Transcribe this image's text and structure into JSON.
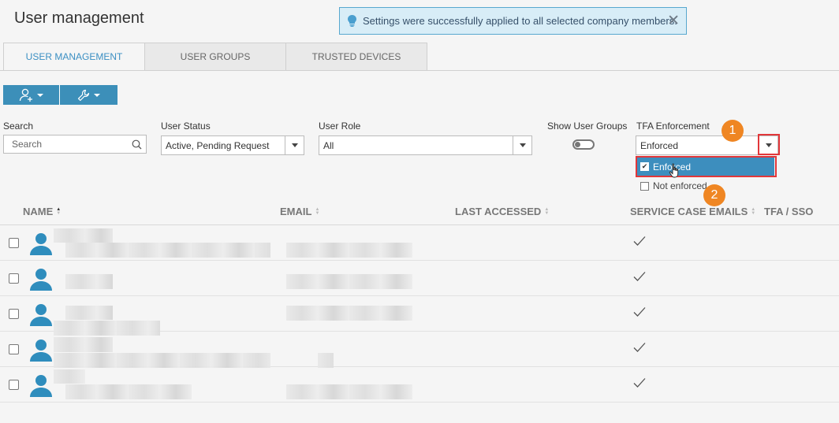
{
  "page": {
    "title": "User management"
  },
  "notification": {
    "message": "Settings were successfully applied to all selected company members.",
    "close": "✕"
  },
  "tabs": [
    {
      "label": "USER MANAGEMENT",
      "active": true
    },
    {
      "label": "USER GROUPS",
      "active": false
    },
    {
      "label": "TRUSTED DEVICES",
      "active": false
    }
  ],
  "toolbar": {
    "add_user_icon": "add-user-icon",
    "settings_icon": "wrench-icon"
  },
  "filters": {
    "search": {
      "label": "Search",
      "placeholder": "Search"
    },
    "user_status": {
      "label": "User Status",
      "value": "Active, Pending Request"
    },
    "user_role": {
      "label": "User Role",
      "value": "All"
    },
    "show_user_groups": {
      "label": "Show User Groups",
      "enabled": false
    },
    "tfa_enforcement": {
      "label": "TFA Enforcement",
      "value": "Enforced",
      "options": [
        {
          "label": "Enforced",
          "checked": true
        },
        {
          "label": "Not enforced",
          "checked": false
        }
      ]
    }
  },
  "annotations": {
    "step1": "1",
    "step2": "2",
    "accent": "#ef8623",
    "highlight": "#e2373a"
  },
  "table": {
    "columns": [
      {
        "label": "NAME",
        "sort": "asc"
      },
      {
        "label": "EMAIL",
        "sort": "none"
      },
      {
        "label": "LAST ACCESSED",
        "sort": "none"
      },
      {
        "label": "SERVICE CASE EMAILS",
        "sort": "none"
      },
      {
        "label": "TFA / SSO",
        "sort": null
      }
    ],
    "rows": [
      {
        "service_case_emails": true
      },
      {
        "service_case_emails": true
      },
      {
        "service_case_emails": true
      },
      {
        "service_case_emails": true
      },
      {
        "service_case_emails": true
      }
    ]
  },
  "colors": {
    "primary": "#3c8fb9",
    "avatar": "#2f8dbd",
    "selected_option": "#3d8ebe"
  }
}
